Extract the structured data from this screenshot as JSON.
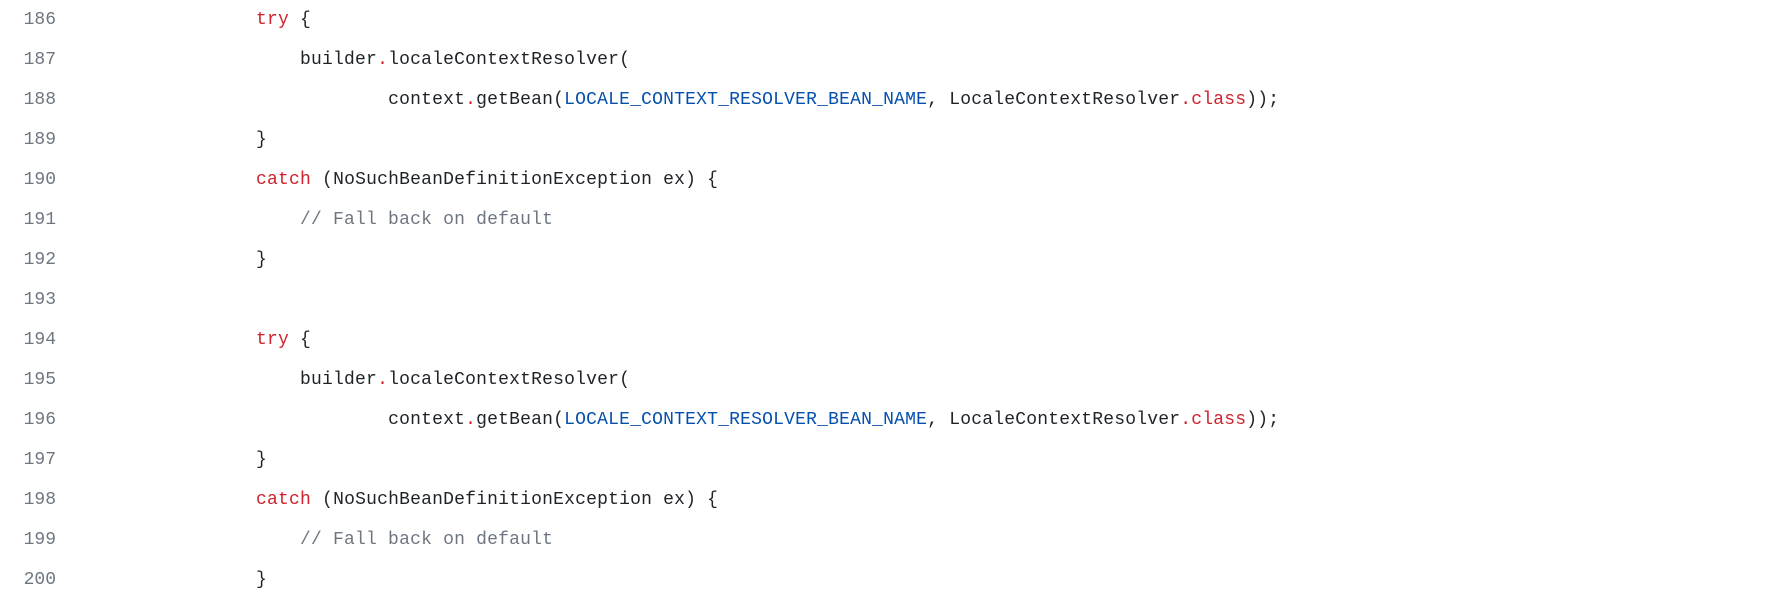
{
  "code": {
    "lines": [
      {
        "num": "186",
        "indent": "                ",
        "tokens": [
          {
            "cls": "kw",
            "t": "try"
          },
          {
            "cls": "pun",
            "t": " {"
          }
        ]
      },
      {
        "num": "187",
        "indent": "                    ",
        "tokens": [
          {
            "cls": "id",
            "t": "builder"
          },
          {
            "cls": "dot",
            "t": "."
          },
          {
            "cls": "id",
            "t": "localeContextResolver"
          },
          {
            "cls": "pun",
            "t": "("
          }
        ]
      },
      {
        "num": "188",
        "indent": "                            ",
        "tokens": [
          {
            "cls": "id",
            "t": "context"
          },
          {
            "cls": "dot",
            "t": "."
          },
          {
            "cls": "id",
            "t": "getBean"
          },
          {
            "cls": "pun",
            "t": "("
          },
          {
            "cls": "const",
            "t": "LOCALE_CONTEXT_RESOLVER_BEAN_NAME"
          },
          {
            "cls": "pun",
            "t": ", "
          },
          {
            "cls": "id",
            "t": "LocaleContextResolver"
          },
          {
            "cls": "dot",
            "t": "."
          },
          {
            "cls": "kw",
            "t": "class"
          },
          {
            "cls": "pun",
            "t": "));"
          }
        ]
      },
      {
        "num": "189",
        "indent": "                ",
        "tokens": [
          {
            "cls": "pun",
            "t": "}"
          }
        ]
      },
      {
        "num": "190",
        "indent": "                ",
        "tokens": [
          {
            "cls": "kw",
            "t": "catch"
          },
          {
            "cls": "pun",
            "t": " ("
          },
          {
            "cls": "id",
            "t": "NoSuchBeanDefinitionException ex"
          },
          {
            "cls": "pun",
            "t": ") {"
          }
        ]
      },
      {
        "num": "191",
        "indent": "                    ",
        "tokens": [
          {
            "cls": "cmt",
            "t": "// Fall back on default"
          }
        ]
      },
      {
        "num": "192",
        "indent": "                ",
        "tokens": [
          {
            "cls": "pun",
            "t": "}"
          }
        ]
      },
      {
        "num": "193",
        "indent": "",
        "tokens": []
      },
      {
        "num": "194",
        "indent": "                ",
        "tokens": [
          {
            "cls": "kw",
            "t": "try"
          },
          {
            "cls": "pun",
            "t": " {"
          }
        ]
      },
      {
        "num": "195",
        "indent": "                    ",
        "tokens": [
          {
            "cls": "id",
            "t": "builder"
          },
          {
            "cls": "dot",
            "t": "."
          },
          {
            "cls": "id",
            "t": "localeContextResolver"
          },
          {
            "cls": "pun",
            "t": "("
          }
        ]
      },
      {
        "num": "196",
        "indent": "                            ",
        "tokens": [
          {
            "cls": "id",
            "t": "context"
          },
          {
            "cls": "dot",
            "t": "."
          },
          {
            "cls": "id",
            "t": "getBean"
          },
          {
            "cls": "pun",
            "t": "("
          },
          {
            "cls": "const",
            "t": "LOCALE_CONTEXT_RESOLVER_BEAN_NAME"
          },
          {
            "cls": "pun",
            "t": ", "
          },
          {
            "cls": "id",
            "t": "LocaleContextResolver"
          },
          {
            "cls": "dot",
            "t": "."
          },
          {
            "cls": "kw",
            "t": "class"
          },
          {
            "cls": "pun",
            "t": "));"
          }
        ]
      },
      {
        "num": "197",
        "indent": "                ",
        "tokens": [
          {
            "cls": "pun",
            "t": "}"
          }
        ]
      },
      {
        "num": "198",
        "indent": "                ",
        "tokens": [
          {
            "cls": "kw",
            "t": "catch"
          },
          {
            "cls": "pun",
            "t": " ("
          },
          {
            "cls": "id",
            "t": "NoSuchBeanDefinitionException ex"
          },
          {
            "cls": "pun",
            "t": ") {"
          }
        ]
      },
      {
        "num": "199",
        "indent": "                    ",
        "tokens": [
          {
            "cls": "cmt",
            "t": "// Fall back on default"
          }
        ]
      },
      {
        "num": "200",
        "indent": "                ",
        "tokens": [
          {
            "cls": "pun",
            "t": "}"
          }
        ]
      }
    ]
  }
}
